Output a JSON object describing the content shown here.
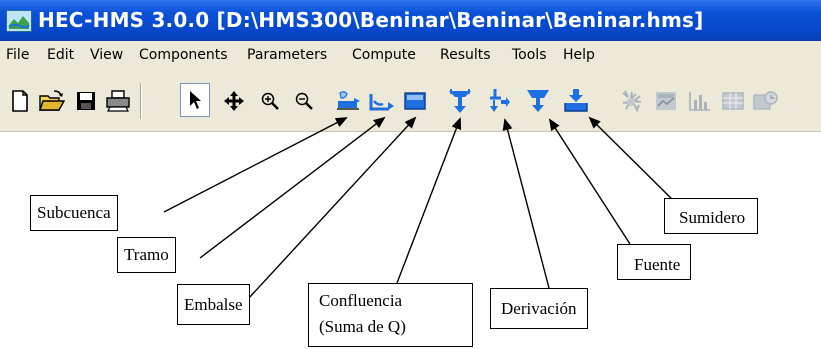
{
  "window": {
    "title": "HEC-HMS 3.0.0 [D:\\HMS300\\Beninar\\Beninar\\Beninar.hms]",
    "icon": "hms-app-icon"
  },
  "menu": [
    "File",
    "Edit",
    "View",
    "Components",
    "Parameters",
    "Compute",
    "Results",
    "Tools",
    "Help"
  ],
  "toolbar": [
    {
      "name": "new-icon"
    },
    {
      "name": "open-folder-icon"
    },
    {
      "name": "save-icon"
    },
    {
      "name": "print-icon"
    },
    {
      "name": "select-arrow-icon"
    },
    {
      "name": "pan-icon"
    },
    {
      "name": "zoom-in-icon"
    },
    {
      "name": "zoom-out-icon"
    },
    {
      "name": "subbasin-icon"
    },
    {
      "name": "reach-icon"
    },
    {
      "name": "reservoir-icon"
    },
    {
      "name": "junction-icon"
    },
    {
      "name": "diversion-icon"
    },
    {
      "name": "source-icon"
    },
    {
      "name": "sink-icon"
    },
    {
      "name": "compute-icon"
    },
    {
      "name": "results-graph-icon"
    },
    {
      "name": "bar-chart-icon"
    },
    {
      "name": "summary-table-icon"
    },
    {
      "name": "time-series-icon"
    }
  ],
  "callouts": {
    "subcuenca": "Subcuenca",
    "tramo": "Tramo",
    "embalse": "Embalse",
    "confluencia_line1": "Confluencia",
    "confluencia_line2": "(Suma de Q)",
    "derivacion": "Derivación",
    "fuente": "Fuente",
    "sumidero": "Sumidero"
  },
  "colors": {
    "titlebar": "#0b52d9",
    "chrome": "#ece9d8",
    "element_blue": "#1f6fe0",
    "disabled": "#a9b3bd"
  }
}
